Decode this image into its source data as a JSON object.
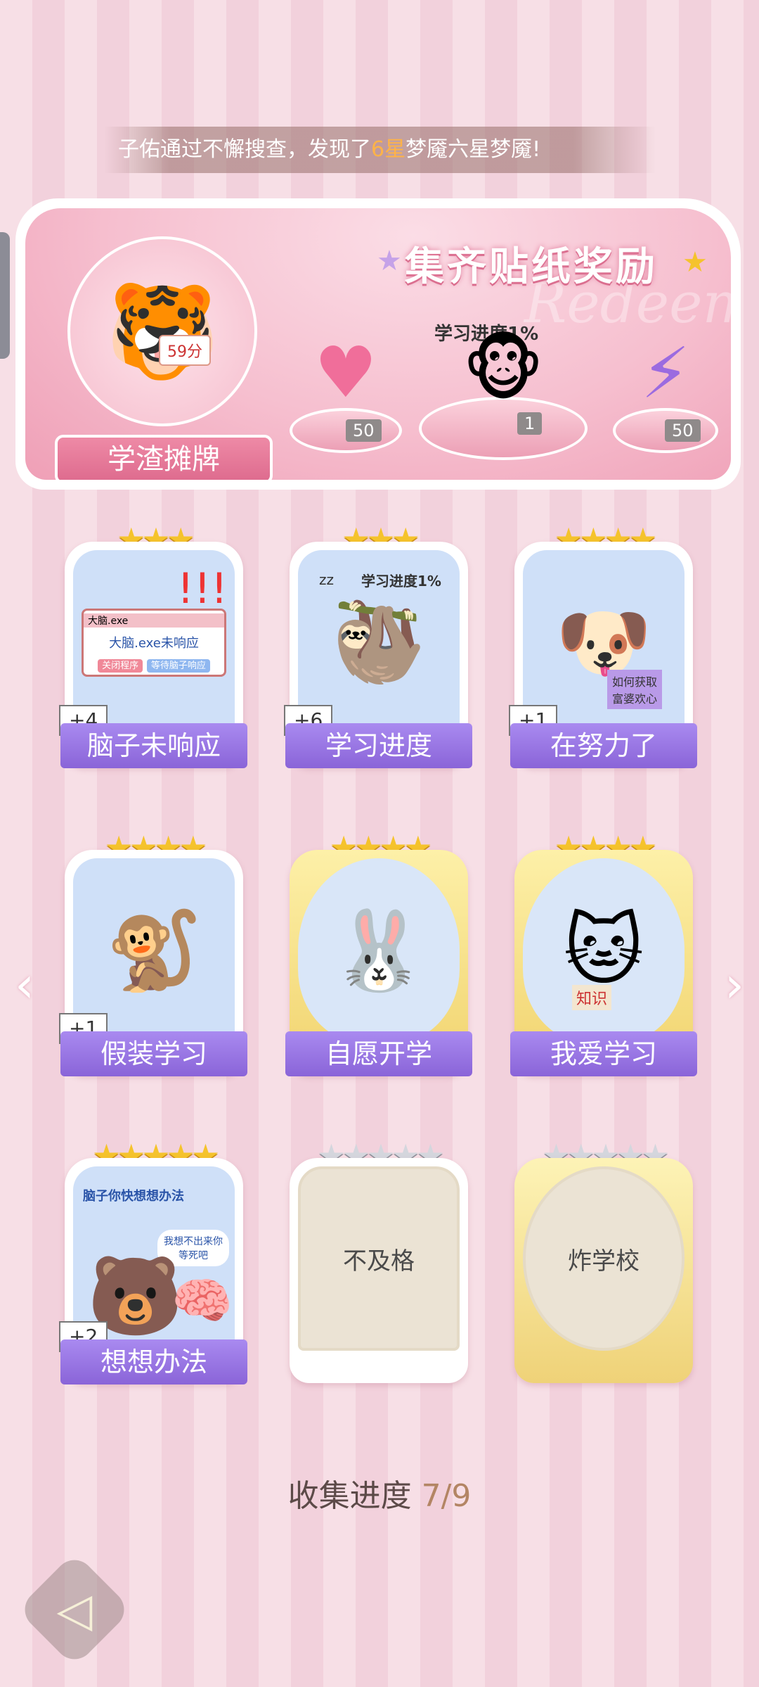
{
  "ticker": {
    "prefix": "子佑通过不懈搜查，发现了",
    "highlight": "6星",
    "suffix": "梦魇六星梦魇!"
  },
  "banner": {
    "title": "集齐贴纸奖励",
    "watermark": "Redeem",
    "avatar_name": "学渣摊牌",
    "score_note": "59分",
    "progress_note": "学习进度1%",
    "rewards": [
      {
        "icon": "pink-heart-gem-icon",
        "qty": "50"
      },
      {
        "icon": "monkey-sticker-icon",
        "qty": "1"
      },
      {
        "icon": "purple-lightning-orb-icon",
        "qty": "50"
      }
    ]
  },
  "cards": [
    {
      "label": "脑子未响应",
      "stars": 3,
      "bonus": "+4",
      "art": "brain-not-responding-dialog"
    },
    {
      "label": "学习进度",
      "stars": 3,
      "bonus": "+6",
      "art": "sleeping-sloth-study-progress"
    },
    {
      "label": "在努力了",
      "stars": 4,
      "bonus": "+1",
      "art": "puppy-reading-book"
    },
    {
      "label": "假装学习",
      "stars": 4,
      "bonus": "+1",
      "art": "monkey-pretend-study"
    },
    {
      "label": "自愿开学",
      "stars": 4,
      "bonus": "",
      "art": "bunny-handcuffed-backpack"
    },
    {
      "label": "我爱学习",
      "stars": 4,
      "bonus": "",
      "art": "angel-cat-reading"
    },
    {
      "label": "想想办法",
      "stars": 5,
      "bonus": "+2",
      "art": "bear-and-brain"
    },
    {
      "label": "不及格",
      "stars": 5,
      "bonus": "",
      "art": "locked"
    },
    {
      "label": "炸学校",
      "stars": 5,
      "bonus": "",
      "art": "locked"
    }
  ],
  "card_texts": {
    "dialog_title": "大脑.exe",
    "dialog_msg": "大脑.exe未响应",
    "dialog_btn1": "关闭程序",
    "dialog_btn2": "等待脑子响应",
    "zz": "zz",
    "sloth_note": "学习进度1%",
    "puppy_book": "如何获取富婆欢心",
    "cat_book": "知识",
    "bear_note1": "脑子你快想想办法",
    "bear_note2": "我想不出来你等死吧"
  },
  "collect": {
    "label": "收集进度",
    "value": "7/9"
  },
  "colors": {
    "accent_purple": "#8a64d8",
    "star_gold": "#f5c32c",
    "ticker_highlight": "#ffb347"
  }
}
